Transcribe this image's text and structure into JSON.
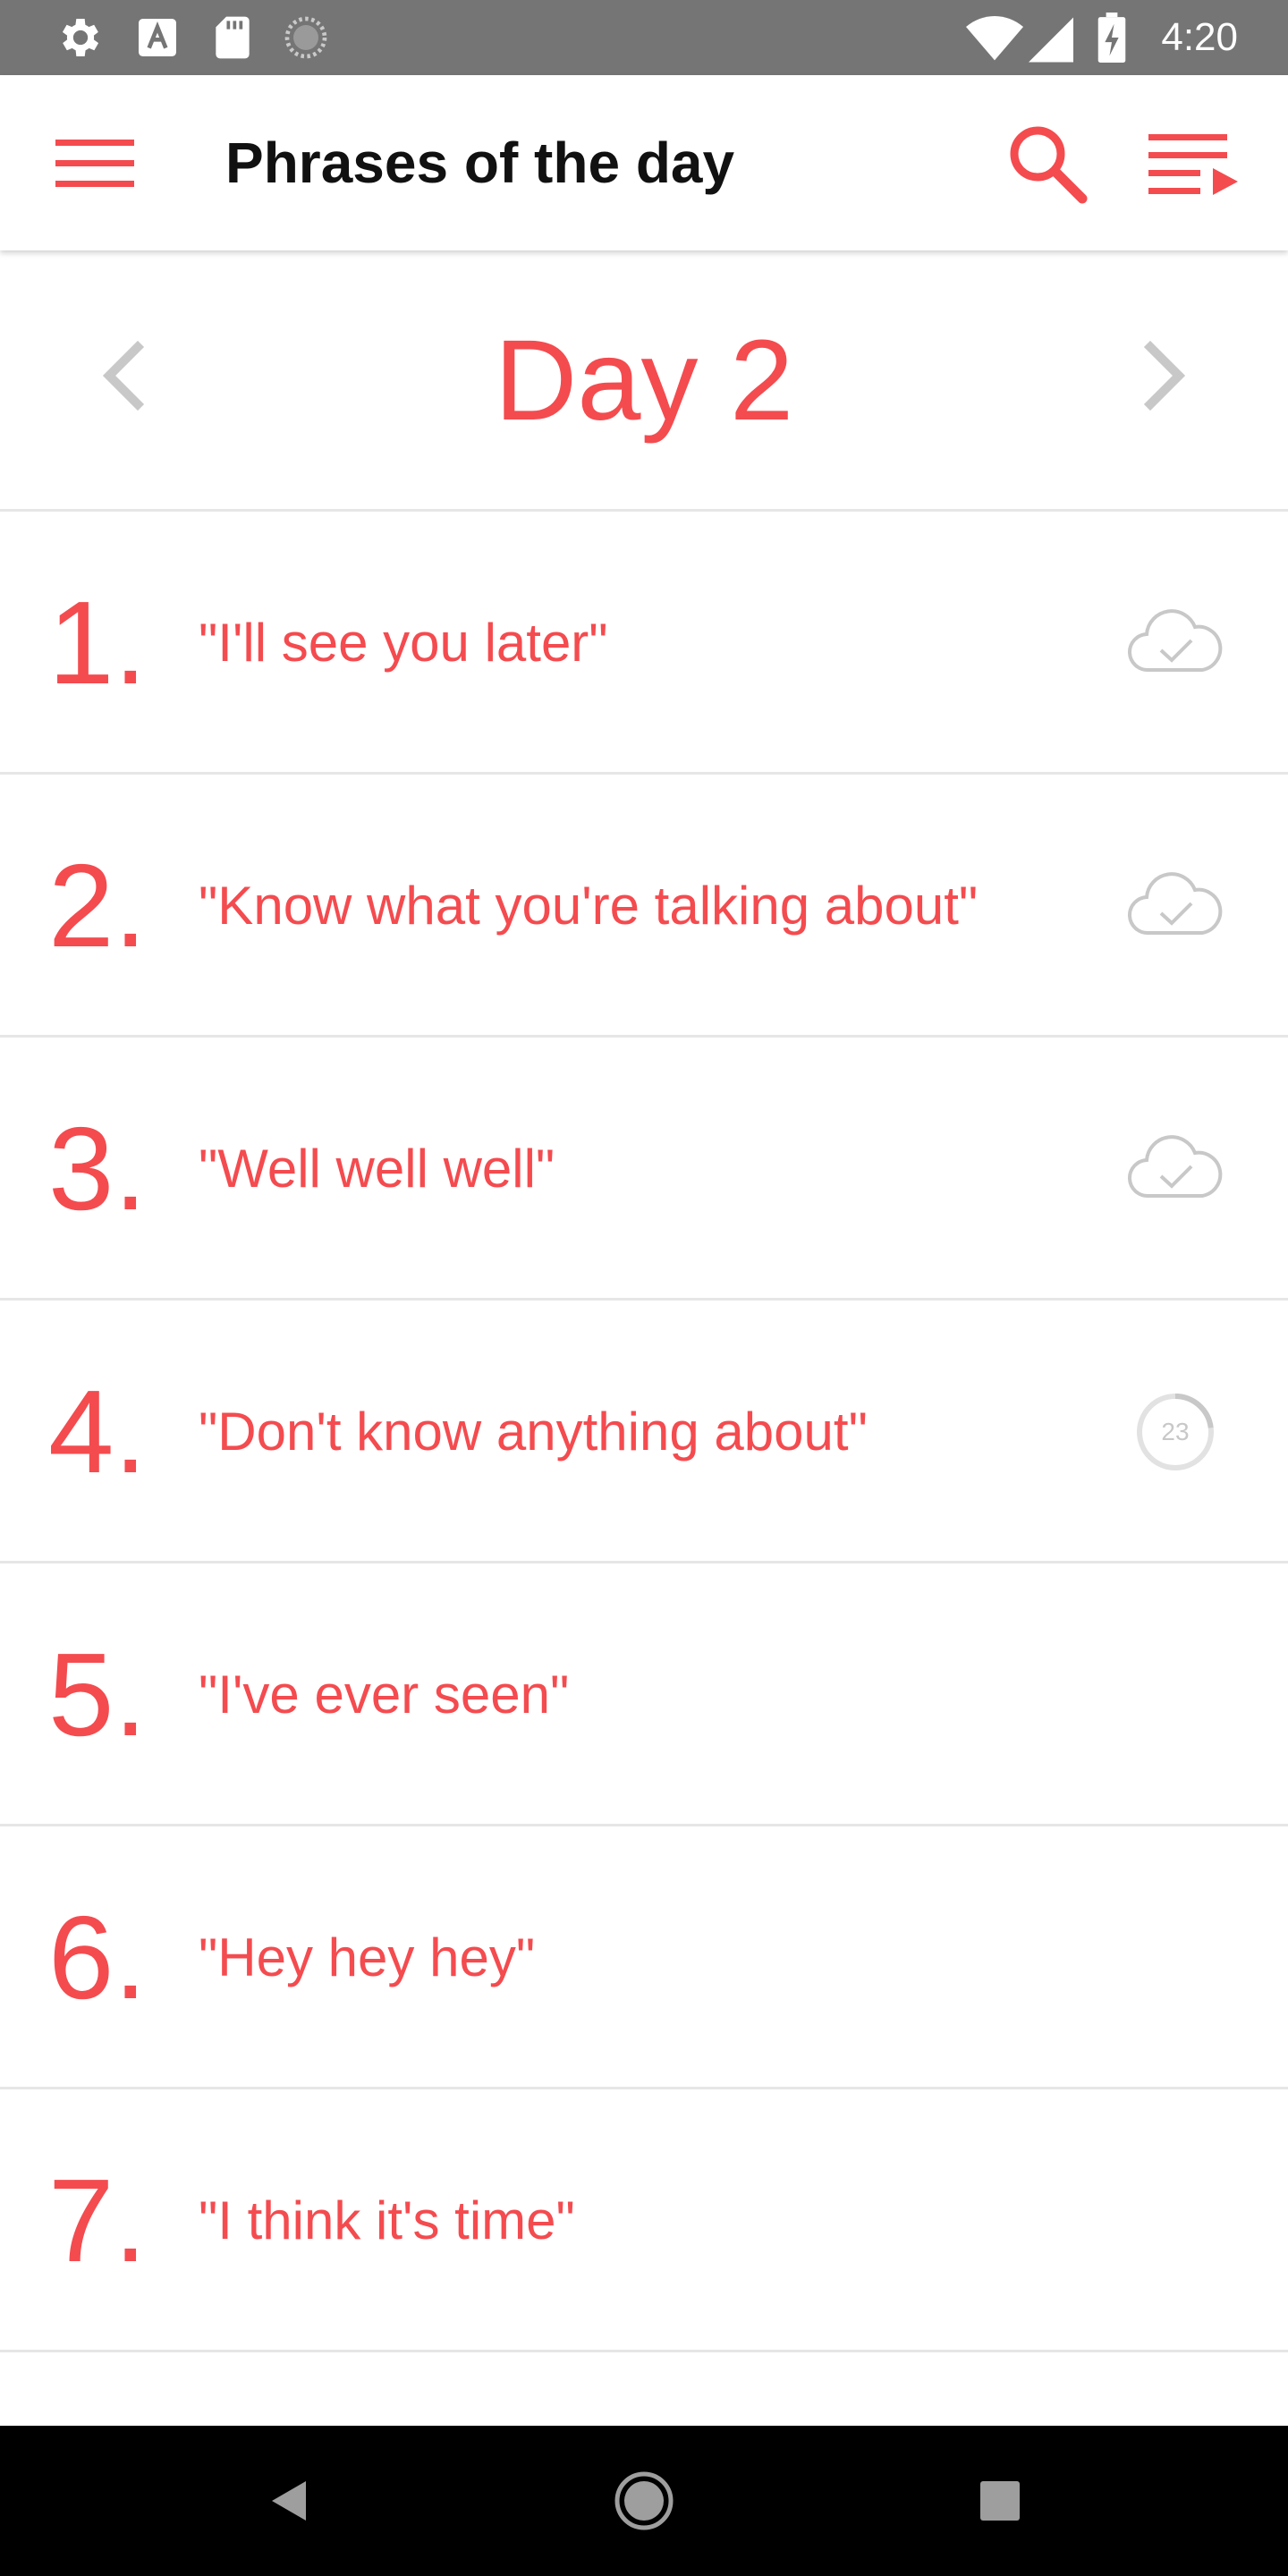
{
  "status_bar": {
    "time": "4:20",
    "icons_left": [
      "settings-icon",
      "font-a-icon",
      "sd-card-icon",
      "sync-spinner-icon"
    ],
    "icons_right": [
      "wifi-icon",
      "signal-icon",
      "battery-charging-icon"
    ]
  },
  "app_bar": {
    "title": "Phrases of the day",
    "left_icon": "hamburger-menu-icon",
    "right_icons": [
      "search-icon",
      "playlist-icon"
    ]
  },
  "day_nav": {
    "title": "Day 2",
    "prev_icon": "chevron-left-icon",
    "next_icon": "chevron-right-icon"
  },
  "phrases": [
    {
      "number": "1.",
      "text": "\"I'll see you later\"",
      "status": "cloud-check-icon"
    },
    {
      "number": "2.",
      "text": "\"Know what you're talking about\"",
      "status": "cloud-check-icon"
    },
    {
      "number": "3.",
      "text": "\"Well well well\"",
      "status": "cloud-check-icon"
    },
    {
      "number": "4.",
      "text": "\"Don't know anything about\"",
      "status": "download-progress",
      "progress_label": "23"
    },
    {
      "number": "5.",
      "text": "\"I've ever seen\"",
      "status": ""
    },
    {
      "number": "6.",
      "text": "\"Hey hey hey\"",
      "status": ""
    },
    {
      "number": "7.",
      "text": "\"I think it's time\"",
      "status": ""
    }
  ],
  "nav_bar": {
    "buttons": [
      "back-icon",
      "home-icon",
      "recents-icon"
    ]
  },
  "colors": {
    "accent": "#f44b4f",
    "status_bar": "#757575",
    "muted_icon": "#c8c8c8",
    "divider": "#e6e6e6"
  }
}
